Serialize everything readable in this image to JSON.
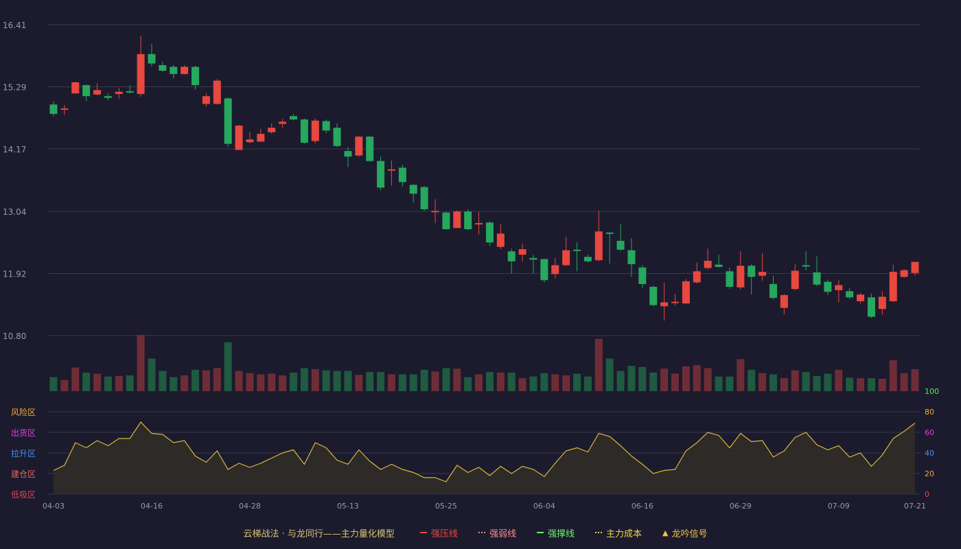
{
  "colors": {
    "background": "#1b1b2d",
    "up": "#e8483f",
    "down": "#26a85e",
    "grid": "#3a3a4e",
    "axis_text": "#9a9aa8",
    "osc_line": "#d9b93a",
    "osc_fill": "#2f2b28"
  },
  "legend": {
    "title": "云梯战法 · 与龙同行——主力量化模型",
    "items": [
      {
        "label": "强压线",
        "color": "#e8483f",
        "style": "solid"
      },
      {
        "label": "强弱线",
        "color": "#ff8a8a",
        "style": "dash"
      },
      {
        "label": "强撑线",
        "color": "#6cf06c",
        "style": "solid"
      },
      {
        "label": "主力成本",
        "color": "#f2d44a",
        "style": "dash"
      },
      {
        "label": "龙吟信号",
        "color": "#f2c040",
        "style": "triangle"
      }
    ]
  },
  "chart_data": [
    {
      "type": "candlestick",
      "y_ticks": [
        "16.41",
        "15.29",
        "14.17",
        "13.04",
        "11.92",
        "10.80"
      ],
      "ylim": [
        10.8,
        16.41
      ],
      "x_ticks": [
        "04-03",
        "04-16",
        "04-28",
        "05-13",
        "05-25",
        "06-04",
        "06-16",
        "06-29",
        "07-09",
        "07-21"
      ],
      "grid": true,
      "candles": [
        [
          14.97,
          14.8,
          15.03,
          14.75
        ],
        [
          14.88,
          14.9,
          14.96,
          14.78
        ],
        [
          15.17,
          15.37,
          15.38,
          15.17
        ],
        [
          15.32,
          15.12,
          15.33,
          15.03
        ],
        [
          15.15,
          15.23,
          15.35,
          15.14
        ],
        [
          15.12,
          15.09,
          15.17,
          15.05
        ],
        [
          15.16,
          15.2,
          15.27,
          15.07
        ],
        [
          15.21,
          15.19,
          15.32,
          15.17
        ],
        [
          15.16,
          15.88,
          16.21,
          15.11
        ],
        [
          15.88,
          15.71,
          16.07,
          15.66
        ],
        [
          15.68,
          15.58,
          15.74,
          15.56
        ],
        [
          15.65,
          15.52,
          15.68,
          15.44
        ],
        [
          15.52,
          15.65,
          15.68,
          15.51
        ],
        [
          15.65,
          15.32,
          15.67,
          15.24
        ],
        [
          14.98,
          15.12,
          15.17,
          14.93
        ],
        [
          14.98,
          15.4,
          15.43,
          14.97
        ],
        [
          15.08,
          14.26,
          15.1,
          14.2
        ],
        [
          14.15,
          14.59,
          14.6,
          14.15
        ],
        [
          14.29,
          14.34,
          14.47,
          14.27
        ],
        [
          14.3,
          14.44,
          14.53,
          14.3
        ],
        [
          14.47,
          14.55,
          14.63,
          14.44
        ],
        [
          14.62,
          14.66,
          14.71,
          14.55
        ],
        [
          14.76,
          14.7,
          14.8,
          14.68
        ],
        [
          14.7,
          14.28,
          14.72,
          14.26
        ],
        [
          14.31,
          14.68,
          14.72,
          14.27
        ],
        [
          14.67,
          14.5,
          14.7,
          14.45
        ],
        [
          14.55,
          14.22,
          14.63,
          14.2
        ],
        [
          14.13,
          14.03,
          14.2,
          13.84
        ],
        [
          14.05,
          14.39,
          14.4,
          14.03
        ],
        [
          14.39,
          13.95,
          14.4,
          13.94
        ],
        [
          13.95,
          13.47,
          14.03,
          13.42
        ],
        [
          13.79,
          13.8,
          13.96,
          13.51
        ],
        [
          13.83,
          13.57,
          13.88,
          13.49
        ],
        [
          13.52,
          13.36,
          13.53,
          13.2
        ],
        [
          13.48,
          13.08,
          13.5,
          13.05
        ],
        [
          13.04,
          13.05,
          13.26,
          12.83
        ],
        [
          13.02,
          12.72,
          13.04,
          12.71
        ],
        [
          12.74,
          13.04,
          13.06,
          12.74
        ],
        [
          13.04,
          12.72,
          13.08,
          12.7
        ],
        [
          12.81,
          12.83,
          13.03,
          12.62
        ],
        [
          12.84,
          12.48,
          12.86,
          12.42
        ],
        [
          12.4,
          12.64,
          12.81,
          12.36
        ],
        [
          12.32,
          12.14,
          12.37,
          11.92
        ],
        [
          12.26,
          12.36,
          12.46,
          12.14
        ],
        [
          12.2,
          12.17,
          12.25,
          11.92
        ],
        [
          12.18,
          11.8,
          12.19,
          11.76
        ],
        [
          11.91,
          12.07,
          12.2,
          11.83
        ],
        [
          12.07,
          12.34,
          12.58,
          12.06
        ],
        [
          12.35,
          12.33,
          12.48,
          11.96
        ],
        [
          12.22,
          12.14,
          12.26,
          12.12
        ],
        [
          12.16,
          12.68,
          13.05,
          12.14
        ],
        [
          12.66,
          12.64,
          12.66,
          12.1
        ],
        [
          12.51,
          12.35,
          12.82,
          12.32
        ],
        [
          12.34,
          12.09,
          12.56,
          11.86
        ],
        [
          12.03,
          11.73,
          12.07,
          11.66
        ],
        [
          11.68,
          11.35,
          11.7,
          11.33
        ],
        [
          11.33,
          11.4,
          11.75,
          11.07
        ],
        [
          11.39,
          11.41,
          11.55,
          11.34
        ],
        [
          11.38,
          11.78,
          11.82,
          11.37
        ],
        [
          11.76,
          11.96,
          12.12,
          11.74
        ],
        [
          12.02,
          12.15,
          12.37,
          11.99
        ],
        [
          12.08,
          12.04,
          12.26,
          12.03
        ],
        [
          11.96,
          11.68,
          12.03,
          11.64
        ],
        [
          11.67,
          12.06,
          12.32,
          11.63
        ],
        [
          12.06,
          11.86,
          12.09,
          11.54
        ],
        [
          11.88,
          11.95,
          12.29,
          11.79
        ],
        [
          11.73,
          11.48,
          11.88,
          11.45
        ],
        [
          11.3,
          11.53,
          11.55,
          11.18
        ],
        [
          11.64,
          11.97,
          12.09,
          11.62
        ],
        [
          12.07,
          12.06,
          12.32,
          11.98
        ],
        [
          11.94,
          11.72,
          12.23,
          11.69
        ],
        [
          11.77,
          11.59,
          11.81,
          11.53
        ],
        [
          11.62,
          11.71,
          11.8,
          11.4
        ],
        [
          11.6,
          11.49,
          11.66,
          11.46
        ],
        [
          11.42,
          11.54,
          11.57,
          11.38
        ],
        [
          11.49,
          11.14,
          11.56,
          11.12
        ],
        [
          11.28,
          11.5,
          11.6,
          11.17
        ],
        [
          11.42,
          11.95,
          12.08,
          11.4
        ],
        [
          11.86,
          11.98,
          12.0,
          11.84
        ],
        [
          11.93,
          12.13,
          12.13,
          11.88
        ]
      ],
      "volume": [
        25,
        20,
        42,
        33,
        31,
        26,
        27,
        28,
        100,
        58,
        36,
        25,
        28,
        38,
        37,
        41,
        87,
        36,
        32,
        30,
        31,
        28,
        33,
        41,
        39,
        37,
        36,
        36,
        29,
        34,
        34,
        30,
        30,
        30,
        38,
        35,
        41,
        40,
        25,
        30,
        34,
        33,
        33,
        23,
        26,
        32,
        30,
        28,
        31,
        26,
        93,
        58,
        36,
        45,
        43,
        33,
        40,
        31,
        44,
        46,
        41,
        26,
        26,
        57,
        38,
        32,
        30,
        23,
        37,
        34,
        27,
        31,
        38,
        24,
        23,
        23,
        22,
        55,
        32,
        39
      ]
    },
    {
      "type": "area",
      "series": [
        {
          "values": [
            23,
            28,
            50,
            45,
            52,
            47,
            54,
            54,
            70,
            59,
            58,
            50,
            52,
            37,
            31,
            42,
            24,
            30,
            26,
            30,
            35,
            40,
            43,
            29,
            50,
            45,
            33,
            29,
            43,
            32,
            24,
            29,
            24,
            21,
            16,
            16,
            12,
            28,
            21,
            26,
            18,
            27,
            20,
            27,
            24,
            17,
            30,
            42,
            45,
            41,
            59,
            56,
            47,
            37,
            29,
            20,
            23,
            24,
            42,
            50,
            60,
            57,
            45,
            59,
            51,
            52,
            36,
            42,
            55,
            60,
            48,
            43,
            47,
            36,
            40,
            27,
            38,
            54,
            61,
            69
          ]
        }
      ],
      "left_labels": [
        "风险区",
        "出货区",
        "拉升区",
        "建仓区",
        "低吸区"
      ],
      "right_ticks": [
        "100",
        "80",
        "60",
        "40",
        "20",
        "0"
      ],
      "ylim": [
        0,
        100
      ]
    }
  ]
}
